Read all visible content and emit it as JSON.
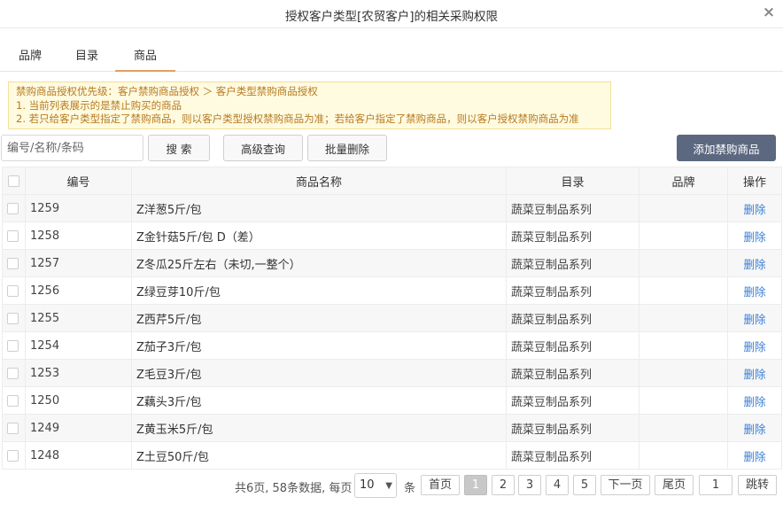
{
  "dialog": {
    "title": "授权客户类型[农贸客户]的相关采购权限",
    "close_icon": "×"
  },
  "tabs": [
    {
      "label": "品牌",
      "active": false
    },
    {
      "label": "目录",
      "active": false
    },
    {
      "label": "商品",
      "active": true
    }
  ],
  "notice": {
    "line1": "禁购商品授权优先级：客户禁购商品授权 ＞ 客户类型禁购商品授权",
    "line2": "1. 当前列表展示的是禁止购买的商品",
    "line3": "2. 若只给客户类型指定了禁购商品，则以客户类型授权禁购商品为准；若给客户指定了禁购商品，则以客户授权禁购商品为准"
  },
  "toolbar": {
    "search_value": "",
    "search_placeholder": "编号/名称/条码",
    "search_label": "搜 索",
    "advanced_label": "高级查询",
    "batch_delete_label": "批量删除",
    "add_label": "添加禁购商品"
  },
  "table": {
    "headers": {
      "id": "编号",
      "name": "商品名称",
      "category": "目录",
      "brand": "品牌",
      "action": "操作"
    },
    "rows": [
      {
        "id": "1259",
        "name": "Z洋葱5斤/包",
        "category": "蔬菜豆制品系列",
        "brand": "",
        "action": "删除"
      },
      {
        "id": "1258",
        "name": "Z金针菇5斤/包 D（差）",
        "category": "蔬菜豆制品系列",
        "brand": "",
        "action": "删除"
      },
      {
        "id": "1257",
        "name": "Z冬瓜25斤左右（未切,一整个）",
        "category": "蔬菜豆制品系列",
        "brand": "",
        "action": "删除"
      },
      {
        "id": "1256",
        "name": "Z绿豆芽10斤/包",
        "category": "蔬菜豆制品系列",
        "brand": "",
        "action": "删除"
      },
      {
        "id": "1255",
        "name": "Z西芹5斤/包",
        "category": "蔬菜豆制品系列",
        "brand": "",
        "action": "删除"
      },
      {
        "id": "1254",
        "name": "Z茄子3斤/包",
        "category": "蔬菜豆制品系列",
        "brand": "",
        "action": "删除"
      },
      {
        "id": "1253",
        "name": "Z毛豆3斤/包",
        "category": "蔬菜豆制品系列",
        "brand": "",
        "action": "删除"
      },
      {
        "id": "1250",
        "name": "Z藕头3斤/包",
        "category": "蔬菜豆制品系列",
        "brand": "",
        "action": "删除"
      },
      {
        "id": "1249",
        "name": "Z黄玉米5斤/包",
        "category": "蔬菜豆制品系列",
        "brand": "",
        "action": "删除"
      },
      {
        "id": "1248",
        "name": "Z土豆50斤/包",
        "category": "蔬菜豆制品系列",
        "brand": "",
        "action": "删除"
      }
    ]
  },
  "pagination": {
    "summary": "共6页, 58条数据, 每页",
    "page_size": "10",
    "unit": "条",
    "first": "首页",
    "pages": [
      "1",
      "2",
      "3",
      "4",
      "5"
    ],
    "current": "1",
    "next": "下一页",
    "last": "尾页",
    "jump_value": "1",
    "jump_label": "跳转"
  }
}
